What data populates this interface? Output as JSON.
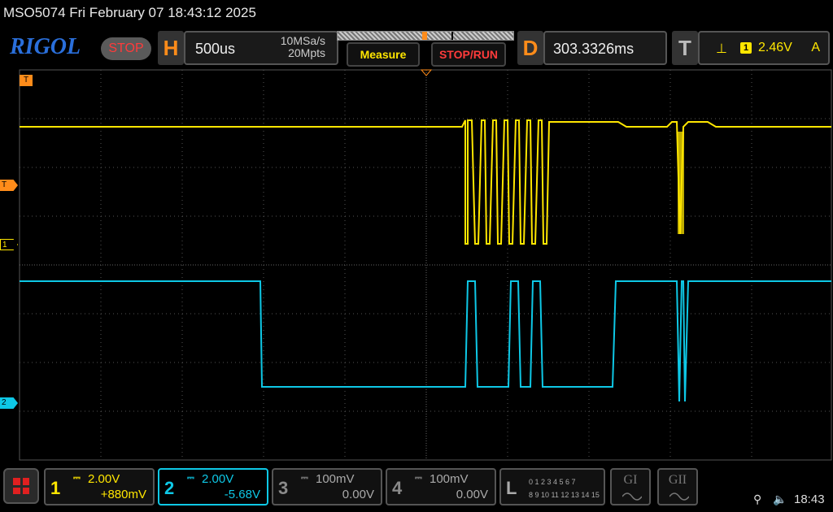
{
  "header": {
    "title": "MSO5074  Fri February 07 18:43:12 2025"
  },
  "toolbar": {
    "logo": "RIGOL",
    "run_state": "STOP",
    "horizontal": {
      "letter": "H",
      "timebase": "500us",
      "sample_rate": "10MSa/s",
      "memory_depth": "20Mpts"
    },
    "measure_label": "Measure",
    "stop_run_label": "STOP/RUN",
    "delay": {
      "letter": "D",
      "value": "303.3326ms"
    },
    "trigger": {
      "letter": "T",
      "edge_icon": "rising-edge-icon",
      "edge_glyph": "⊥",
      "source": "1",
      "level": "2.46V",
      "mode": "A"
    }
  },
  "screen": {
    "trigger_marker": "T",
    "level_marker": "T",
    "ch1_marker": "1",
    "ch2_marker": "2"
  },
  "channels": [
    {
      "num": "1",
      "coupling_glyph": "⎓",
      "scale": "2.00V",
      "offset": "+880mV",
      "color": "#ffe600",
      "active": false
    },
    {
      "num": "2",
      "coupling_glyph": "⎓",
      "scale": "2.00V",
      "offset": "-5.68V",
      "color": "#0ec8e6",
      "active": true
    },
    {
      "num": "3",
      "coupling_glyph": "⎓",
      "scale": "100mV",
      "offset": "0.00V",
      "color": "#8a8a8a",
      "active": false
    },
    {
      "num": "4",
      "coupling_glyph": "⎓",
      "scale": "100mV",
      "offset": "0.00V",
      "color": "#8a8a8a",
      "active": false
    }
  ],
  "logic": {
    "letter": "L",
    "row1": "0 1 2 3   4 5 6 7",
    "row2": "8 9 10 11 12 13 14 15"
  },
  "generators": [
    {
      "label": "GI"
    },
    {
      "label": "GII"
    }
  ],
  "status": {
    "usb_glyph": "⚲",
    "speaker_glyph": "🔈",
    "time": "18:43"
  }
}
